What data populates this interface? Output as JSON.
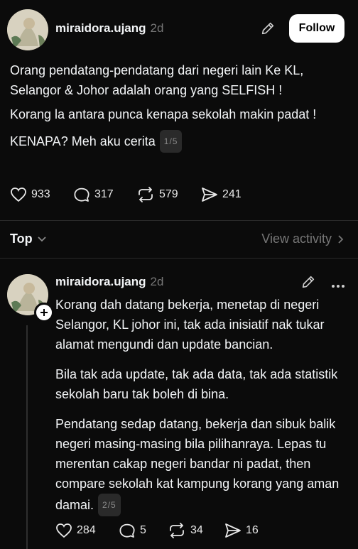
{
  "post": {
    "username": "miraidora.ujang",
    "time": "2d",
    "follow_label": "Follow",
    "paragraphs": [
      "Orang pendatang-pendatang dari negeri lain Ke KL, Selangor & Johor adalah orang yang SELFISH !",
      "Korang la antara punca kenapa sekolah makin padat !",
      "KENAPA? Meh aku cerita"
    ],
    "thread_pos": "1/5",
    "likes": "933",
    "replies": "317",
    "reposts": "579",
    "shares": "241"
  },
  "sort": {
    "label": "Top",
    "view_activity": "View activity"
  },
  "reply": {
    "username": "miraidora.ujang",
    "time": "2d",
    "paragraphs": [
      "Korang dah datang bekerja, menetap di negeri Selangor, KL johor ini, tak ada inisiatif nak tukar alamat mengundi dan update bancian.",
      "Bila tak ada update, tak ada data, tak ada statistik sekolah baru tak boleh di bina.",
      "Pendatang sedap datang, bekerja dan sibuk balik negeri masing-masing bila pilihanraya. Lepas tu merentan cakap negeri bandar ni padat, then compare sekolah kat kampung korang yang aman damai."
    ],
    "thread_pos": "2/5",
    "likes": "284",
    "replies": "5",
    "reposts": "34",
    "shares": "16"
  },
  "icons": {
    "edit": "pencil-icon",
    "like": "heart-icon",
    "reply": "speech-bubble-icon",
    "repost": "repost-icon",
    "share": "send-icon",
    "more": "ellipsis-icon",
    "add": "plus-icon"
  }
}
